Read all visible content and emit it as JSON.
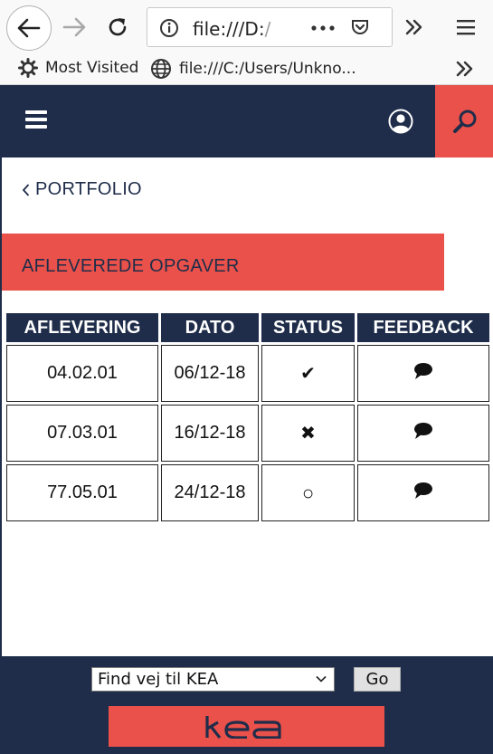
{
  "browser": {
    "url_visible": "file:///D:",
    "url_overflow": "/",
    "bookmarks": [
      {
        "label": "Most Visited",
        "icon": "gear-icon"
      },
      {
        "label": "file:///C:/Users/Unkno...",
        "icon": "globe-icon"
      }
    ]
  },
  "header": {
    "menu_icon": "hamburger-icon",
    "user_icon": "user-icon",
    "search_icon": "search-icon"
  },
  "page": {
    "back_label": "PORTFOLIO",
    "section_title": "AFLEVEREDE OPGAVER"
  },
  "table": {
    "headers": [
      "AFLEVERING",
      "DATO",
      "STATUS",
      "FEEDBACK"
    ],
    "rows": [
      {
        "aflevering": "04.02.01",
        "dato": "06/12-18",
        "status": "✔",
        "status_meaning": "approved"
      },
      {
        "aflevering": "07.03.01",
        "dato": "16/12-18",
        "status": "✖",
        "status_meaning": "rejected"
      },
      {
        "aflevering": "77.05.01",
        "dato": "24/12-18",
        "status": "○",
        "status_meaning": "pending"
      }
    ],
    "feedback_icon": "speech-bubble-icon"
  },
  "footer": {
    "select_value": "Find vej til KEA",
    "go_label": "Go",
    "logo_text": "kea"
  },
  "colors": {
    "navy": "#1f2d4a",
    "coral": "#e9514a"
  }
}
